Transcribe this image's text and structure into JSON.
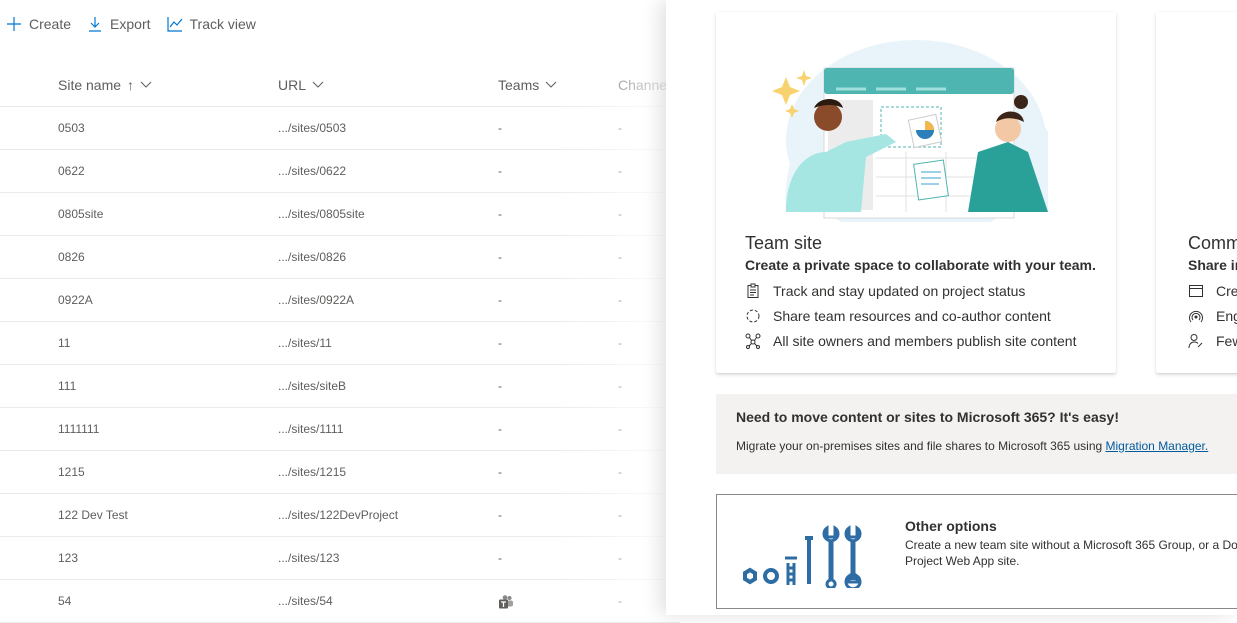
{
  "toolbar": {
    "create": "Create",
    "export": "Export",
    "track_view": "Track view"
  },
  "columns": {
    "site_name": "Site name",
    "url": "URL",
    "teams": "Teams",
    "channel": "Channe"
  },
  "rows": [
    {
      "name": "0503",
      "url": ".../sites/0503",
      "teams": "-",
      "channel": "-"
    },
    {
      "name": "0622",
      "url": ".../sites/0622",
      "teams": "-",
      "channel": "-"
    },
    {
      "name": "0805site",
      "url": ".../sites/0805site",
      "teams": "-",
      "channel": "-"
    },
    {
      "name": "0826",
      "url": ".../sites/0826",
      "teams": "-",
      "channel": "-"
    },
    {
      "name": "0922A",
      "url": ".../sites/0922A",
      "teams": "-",
      "channel": "-"
    },
    {
      "name": "11",
      "url": ".../sites/11",
      "teams": "-",
      "channel": "-"
    },
    {
      "name": "111",
      "url": ".../sites/siteB",
      "teams": "-",
      "channel": "-"
    },
    {
      "name": "1111111",
      "url": ".../sites/1111",
      "teams": "-",
      "channel": "-"
    },
    {
      "name": "1215",
      "url": ".../sites/1215",
      "teams": "-",
      "channel": "-"
    },
    {
      "name": "122 Dev Test",
      "url": ".../sites/122DevProject",
      "teams": "-",
      "channel": "-"
    },
    {
      "name": "123",
      "url": ".../sites/123",
      "teams": "-",
      "channel": "-"
    },
    {
      "name": "54",
      "url": ".../sites/54",
      "teams": "teams-icon",
      "channel": "-"
    }
  ],
  "panel": {
    "team_site": {
      "title": "Team site",
      "subtitle": "Create a private space to collaborate with your team.",
      "features": [
        "Track and stay updated on project status",
        "Share team resources and co-author content",
        "All site owners and members publish site content"
      ]
    },
    "communication_site": {
      "title": "Comm",
      "subtitle": "Share in",
      "features": [
        "Crea",
        "Eng",
        "Few"
      ]
    },
    "migration": {
      "title": "Need to move content or sites to Microsoft 365? It's easy!",
      "desc": "Migrate your on-premises sites and file shares to Microsoft 365 using ",
      "link": "Migration Manager."
    },
    "other": {
      "title": "Other options",
      "desc": "Create a new team site without a Microsoft 365 Group, or a Do",
      "desc2": "Project Web App site."
    }
  },
  "colors": {
    "accent": "#0078d4",
    "teal": "#4fb5b0",
    "link": "#005a9e",
    "icon_blue": "#2e6da4"
  }
}
